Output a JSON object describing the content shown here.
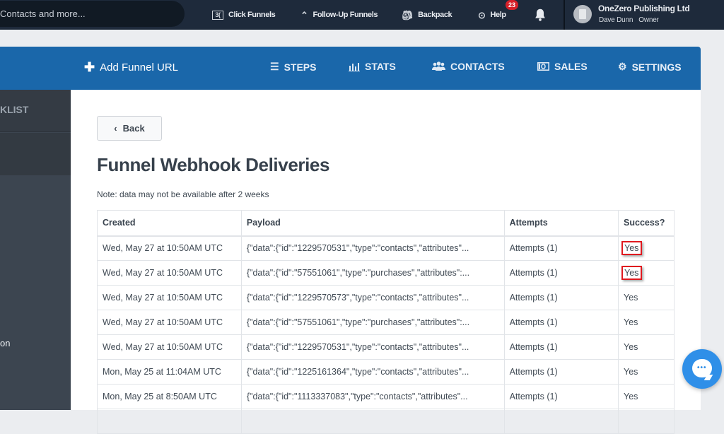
{
  "topbar": {
    "search_placeholder": "Contacts and more...",
    "nav": [
      {
        "label": "Click Funnels",
        "icon": "clickfunnels-logo-icon"
      },
      {
        "label": "Follow-Up Funnels",
        "icon": "double-chevron-up-icon"
      },
      {
        "label": "Backpack",
        "icon": "backpack-icon"
      },
      {
        "label": "Help",
        "icon": "lifebuoy-icon"
      }
    ],
    "help_badge": "23",
    "account": {
      "org_name": "OneZero Publishing Ltd",
      "user_name": "Dave Dunn",
      "role": "Owner"
    }
  },
  "funnelbar": {
    "add_url_label": "Add Funnel URL",
    "tabs": [
      {
        "label": "STEPS",
        "icon": "list-icon"
      },
      {
        "label": "STATS",
        "icon": "bar-chart-icon"
      },
      {
        "label": "CONTACTS",
        "icon": "users-icon"
      },
      {
        "label": "SALES",
        "icon": "money-icon"
      },
      {
        "label": "SETTINGS",
        "icon": "gear-icon"
      }
    ]
  },
  "sidebar": {
    "top_label": "KLIST",
    "lower_label": "on"
  },
  "main": {
    "back_label": "Back",
    "title": "Funnel Webhook Deliveries",
    "note": "Note: data may not be available after 2 weeks",
    "table": {
      "columns": [
        "Created",
        "Payload",
        "Attempts",
        "Success?"
      ],
      "rows": [
        {
          "created": "Wed, May 27 at 10:50AM UTC",
          "payload": "{\"data\":{\"id\":\"1229570531\",\"type\":\"contacts\",\"attributes\"...",
          "attempts": "Attempts (1)",
          "success": "Yes",
          "highlighted": true
        },
        {
          "created": "Wed, May 27 at 10:50AM UTC",
          "payload": "{\"data\":{\"id\":\"57551061\",\"type\":\"purchases\",\"attributes\":...",
          "attempts": "Attempts (1)",
          "success": "Yes",
          "highlighted": true
        },
        {
          "created": "Wed, May 27 at 10:50AM UTC",
          "payload": "{\"data\":{\"id\":\"1229570573\",\"type\":\"contacts\",\"attributes\"...",
          "attempts": "Attempts (1)",
          "success": "Yes",
          "highlighted": false
        },
        {
          "created": "Wed, May 27 at 10:50AM UTC",
          "payload": "{\"data\":{\"id\":\"57551061\",\"type\":\"purchases\",\"attributes\":...",
          "attempts": "Attempts (1)",
          "success": "Yes",
          "highlighted": false
        },
        {
          "created": "Wed, May 27 at 10:50AM UTC",
          "payload": "{\"data\":{\"id\":\"1229570531\",\"type\":\"contacts\",\"attributes\"...",
          "attempts": "Attempts (1)",
          "success": "Yes",
          "highlighted": false
        },
        {
          "created": "Mon, May 25 at 11:04AM UTC",
          "payload": "{\"data\":{\"id\":\"1225161364\",\"type\":\"contacts\",\"attributes\"...",
          "attempts": "Attempts (1)",
          "success": "Yes",
          "highlighted": false
        },
        {
          "created": "Mon, May 25 at 8:50AM UTC",
          "payload": "{\"data\":{\"id\":\"1113337083\",\"type\":\"contacts\",\"attributes\"...",
          "attempts": "Attempts (1)",
          "success": "Yes",
          "highlighted": false
        }
      ]
    }
  },
  "colors": {
    "topbar_bg": "#1e2a3b",
    "funnelbar_bg": "#1a67aa",
    "link": "#2d78c4",
    "highlight_box": "#e0191f",
    "chat_button": "#2f8fe8"
  }
}
